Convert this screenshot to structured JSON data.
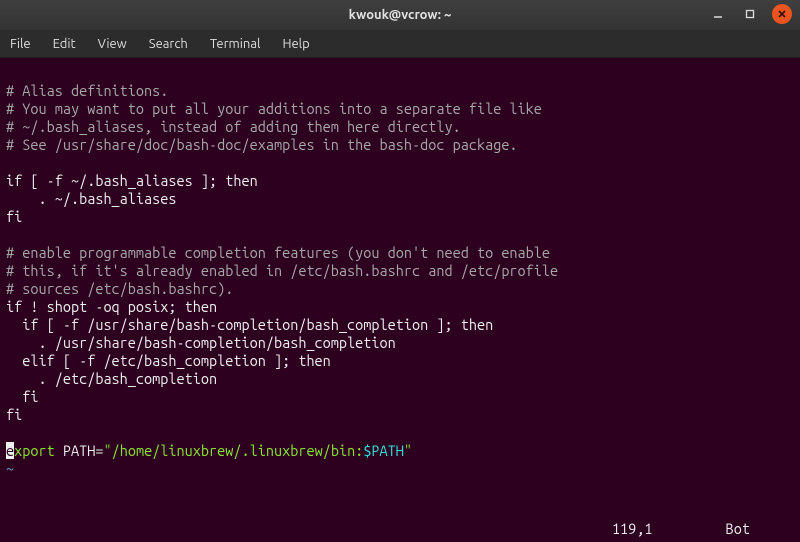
{
  "window": {
    "title": "kwouk@vcrow: ~"
  },
  "menu": {
    "file": "File",
    "edit": "Edit",
    "view": "View",
    "search": "Search",
    "terminal": "Terminal",
    "help": "Help"
  },
  "lines": {
    "l1": "# Alias definitions.",
    "l2": "# You may want to put all your additions into a separate file like",
    "l3": "# ~/.bash_aliases, instead of adding them here directly.",
    "l4": "# See /usr/share/doc/bash-doc/examples in the bash-doc package.",
    "l5": "",
    "l6": "if [ -f ~/.bash_aliases ]; then",
    "l7": "    . ~/.bash_aliases",
    "l8": "fi",
    "l9": "",
    "l10": "# enable programmable completion features (you don't need to enable",
    "l11": "# this, if it's already enabled in /etc/bash.bashrc and /etc/profile",
    "l12": "# sources /etc/bash.bashrc).",
    "l13": "if ! shopt -oq posix; then",
    "l14": "  if [ -f /usr/share/bash-completion/bash_completion ]; then",
    "l15": "    . /usr/share/bash-completion/bash_completion",
    "l16": "  elif [ -f /etc/bash_completion ]; then",
    "l17": "    . /etc/bash_completion",
    "l18": "  fi",
    "l19": "fi",
    "l20": "",
    "l21_e": "e",
    "l21_xport": "xport",
    "l21_path": " PATH=",
    "l21_q1": "\"/home/linuxbrew/.linuxbrew/bin:",
    "l21_var": "$PATH",
    "l21_q2": "\"",
    "l22": "~"
  },
  "status": {
    "pos": "119,1         ",
    "mode": "Bot"
  }
}
